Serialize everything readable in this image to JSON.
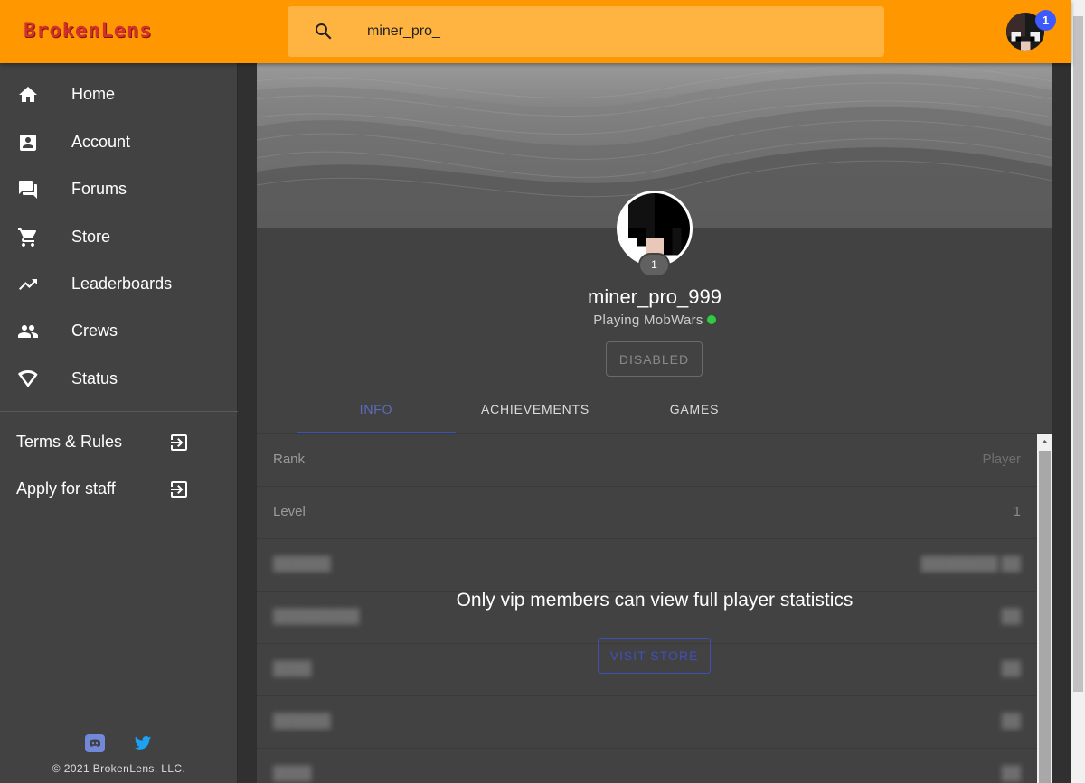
{
  "brand": {
    "logo_text": "BrokenLens",
    "accent": "#ff9800",
    "logo_color": "#d32f2f"
  },
  "search": {
    "value": "miner_pro_",
    "icon": "search-icon"
  },
  "notifications": {
    "count": "1"
  },
  "sidebar": {
    "items": [
      {
        "label": "Home",
        "icon": "home-icon"
      },
      {
        "label": "Account",
        "icon": "account-box-icon"
      },
      {
        "label": "Forums",
        "icon": "forum-icon"
      },
      {
        "label": "Store",
        "icon": "cart-icon"
      },
      {
        "label": "Leaderboards",
        "icon": "trending-up-icon"
      },
      {
        "label": "Crews",
        "icon": "people-icon"
      },
      {
        "label": "Status",
        "icon": "signal-icon"
      }
    ],
    "external": [
      {
        "label": "Terms & Rules",
        "icon": "exit-to-app-icon"
      },
      {
        "label": "Apply for staff",
        "icon": "exit-to-app-icon"
      }
    ],
    "social": [
      "discord-icon",
      "twitter-icon"
    ],
    "copyright": "© 2021 BrokenLens, LLC."
  },
  "profile": {
    "level": "1",
    "username": "miner_pro_999",
    "status_text": "Playing MobWars",
    "status_color": "#2ecc40",
    "disabled_label": "DISABLED"
  },
  "tabs": [
    {
      "label": "INFO",
      "active": true
    },
    {
      "label": "ACHIEVEMENTS",
      "active": false
    },
    {
      "label": "GAMES",
      "active": false
    }
  ],
  "stats": {
    "rows": [
      {
        "label": "Rank",
        "value": "Player"
      },
      {
        "label": "Level",
        "value": "1"
      }
    ],
    "vip_message": "Only vip members can view full player statistics",
    "visit_store_label": "VISIT STORE"
  }
}
